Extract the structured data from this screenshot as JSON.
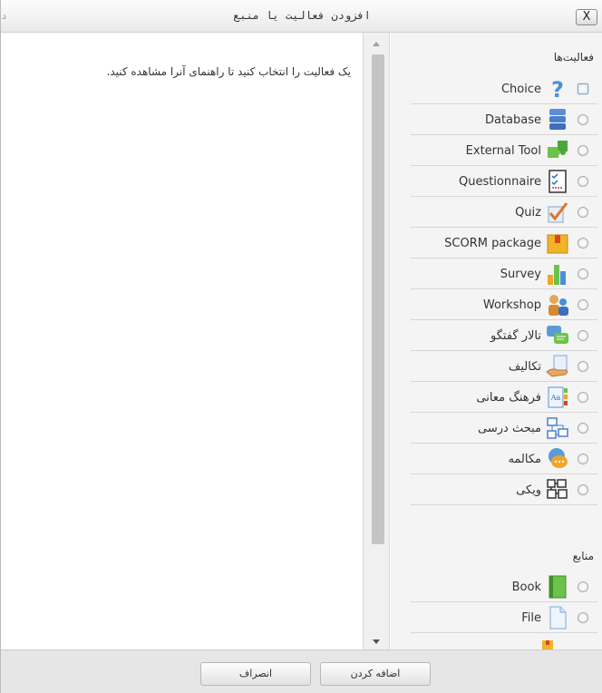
{
  "dialog": {
    "title": "افزودن فعالیت یا منبع",
    "close_label": "X",
    "corner_glyph": "د"
  },
  "help": {
    "message": "یک فعالیت را انتخاب کنید تا راهنمای آنرا مشاهده کنید."
  },
  "sections": {
    "activities_title": "فعالیت‌ها",
    "resources_title": "منابع"
  },
  "activities": [
    {
      "label": "Choice",
      "icon": "question-mark-icon",
      "selected": true
    },
    {
      "label": "Database",
      "icon": "database-icon",
      "selected": false
    },
    {
      "label": "External Tool",
      "icon": "puzzle-piece-icon",
      "selected": false
    },
    {
      "label": "Questionnaire",
      "icon": "checklist-icon",
      "selected": false
    },
    {
      "label": "Quiz",
      "icon": "checkmark-icon",
      "selected": false
    },
    {
      "label": "SCORM package",
      "icon": "package-box-icon",
      "selected": false
    },
    {
      "label": "Survey",
      "icon": "bar-chart-icon",
      "selected": false
    },
    {
      "label": "Workshop",
      "icon": "people-icon",
      "selected": false
    },
    {
      "label": "تالار گفتگو",
      "icon": "forum-bubbles-icon",
      "selected": false
    },
    {
      "label": "تکالیف",
      "icon": "assignment-hand-icon",
      "selected": false
    },
    {
      "label": "فرهنگ معانی",
      "icon": "glossary-icon",
      "selected": false
    },
    {
      "label": "مبحث درسی",
      "icon": "lesson-flow-icon",
      "selected": false
    },
    {
      "label": "مکالمه",
      "icon": "chat-bubble-icon",
      "selected": false
    },
    {
      "label": "ویکی",
      "icon": "wiki-blocks-icon",
      "selected": false
    }
  ],
  "resources": [
    {
      "label": "Book",
      "icon": "book-icon",
      "selected": false
    },
    {
      "label": "File",
      "icon": "file-icon",
      "selected": false
    }
  ],
  "footer": {
    "add_label": "اضافه کردن",
    "cancel_label": "انصراف"
  }
}
